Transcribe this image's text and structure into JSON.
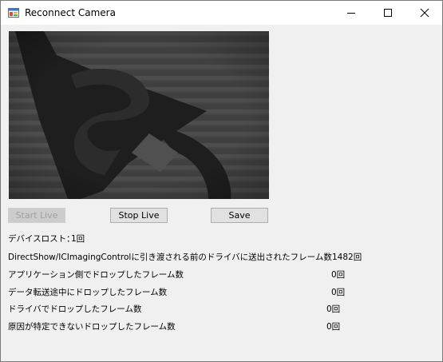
{
  "window": {
    "title": "Reconnect Camera"
  },
  "buttons": {
    "start_live": "Start Live",
    "start_live_enabled": false,
    "stop_live": "Stop Live",
    "save": "Save"
  },
  "stats": {
    "device_lost_label": "デバイスロスト：",
    "device_lost_value": "1回",
    "delivered_label": "DirectShow/ICImagingControlに引き渡される前のドライバに送出されたフレーム数",
    "delivered_value": "1482回",
    "app_dropped_label": "アプリケーション側でドロップしたフレーム数",
    "app_dropped_value": "0回",
    "transfer_dropped_label": "データ転送途中にドロップしたフレーム数",
    "transfer_dropped_value": "0回",
    "driver_dropped_label": "ドライバでドロップしたフレーム数",
    "driver_dropped_value": "0回",
    "unknown_dropped_label": "原因が特定できないドロップしたフレーム数",
    "unknown_dropped_value": "0回"
  },
  "icons": {
    "app": "window-app-icon",
    "minimize": "minimize-icon",
    "maximize": "maximize-icon",
    "close": "close-icon"
  },
  "colors": {
    "window_bg": "#f0f0f0",
    "titlebar_bg": "#ffffff",
    "button_bg": "#e1e1e1",
    "disabled_text": "#a0a0a0"
  }
}
